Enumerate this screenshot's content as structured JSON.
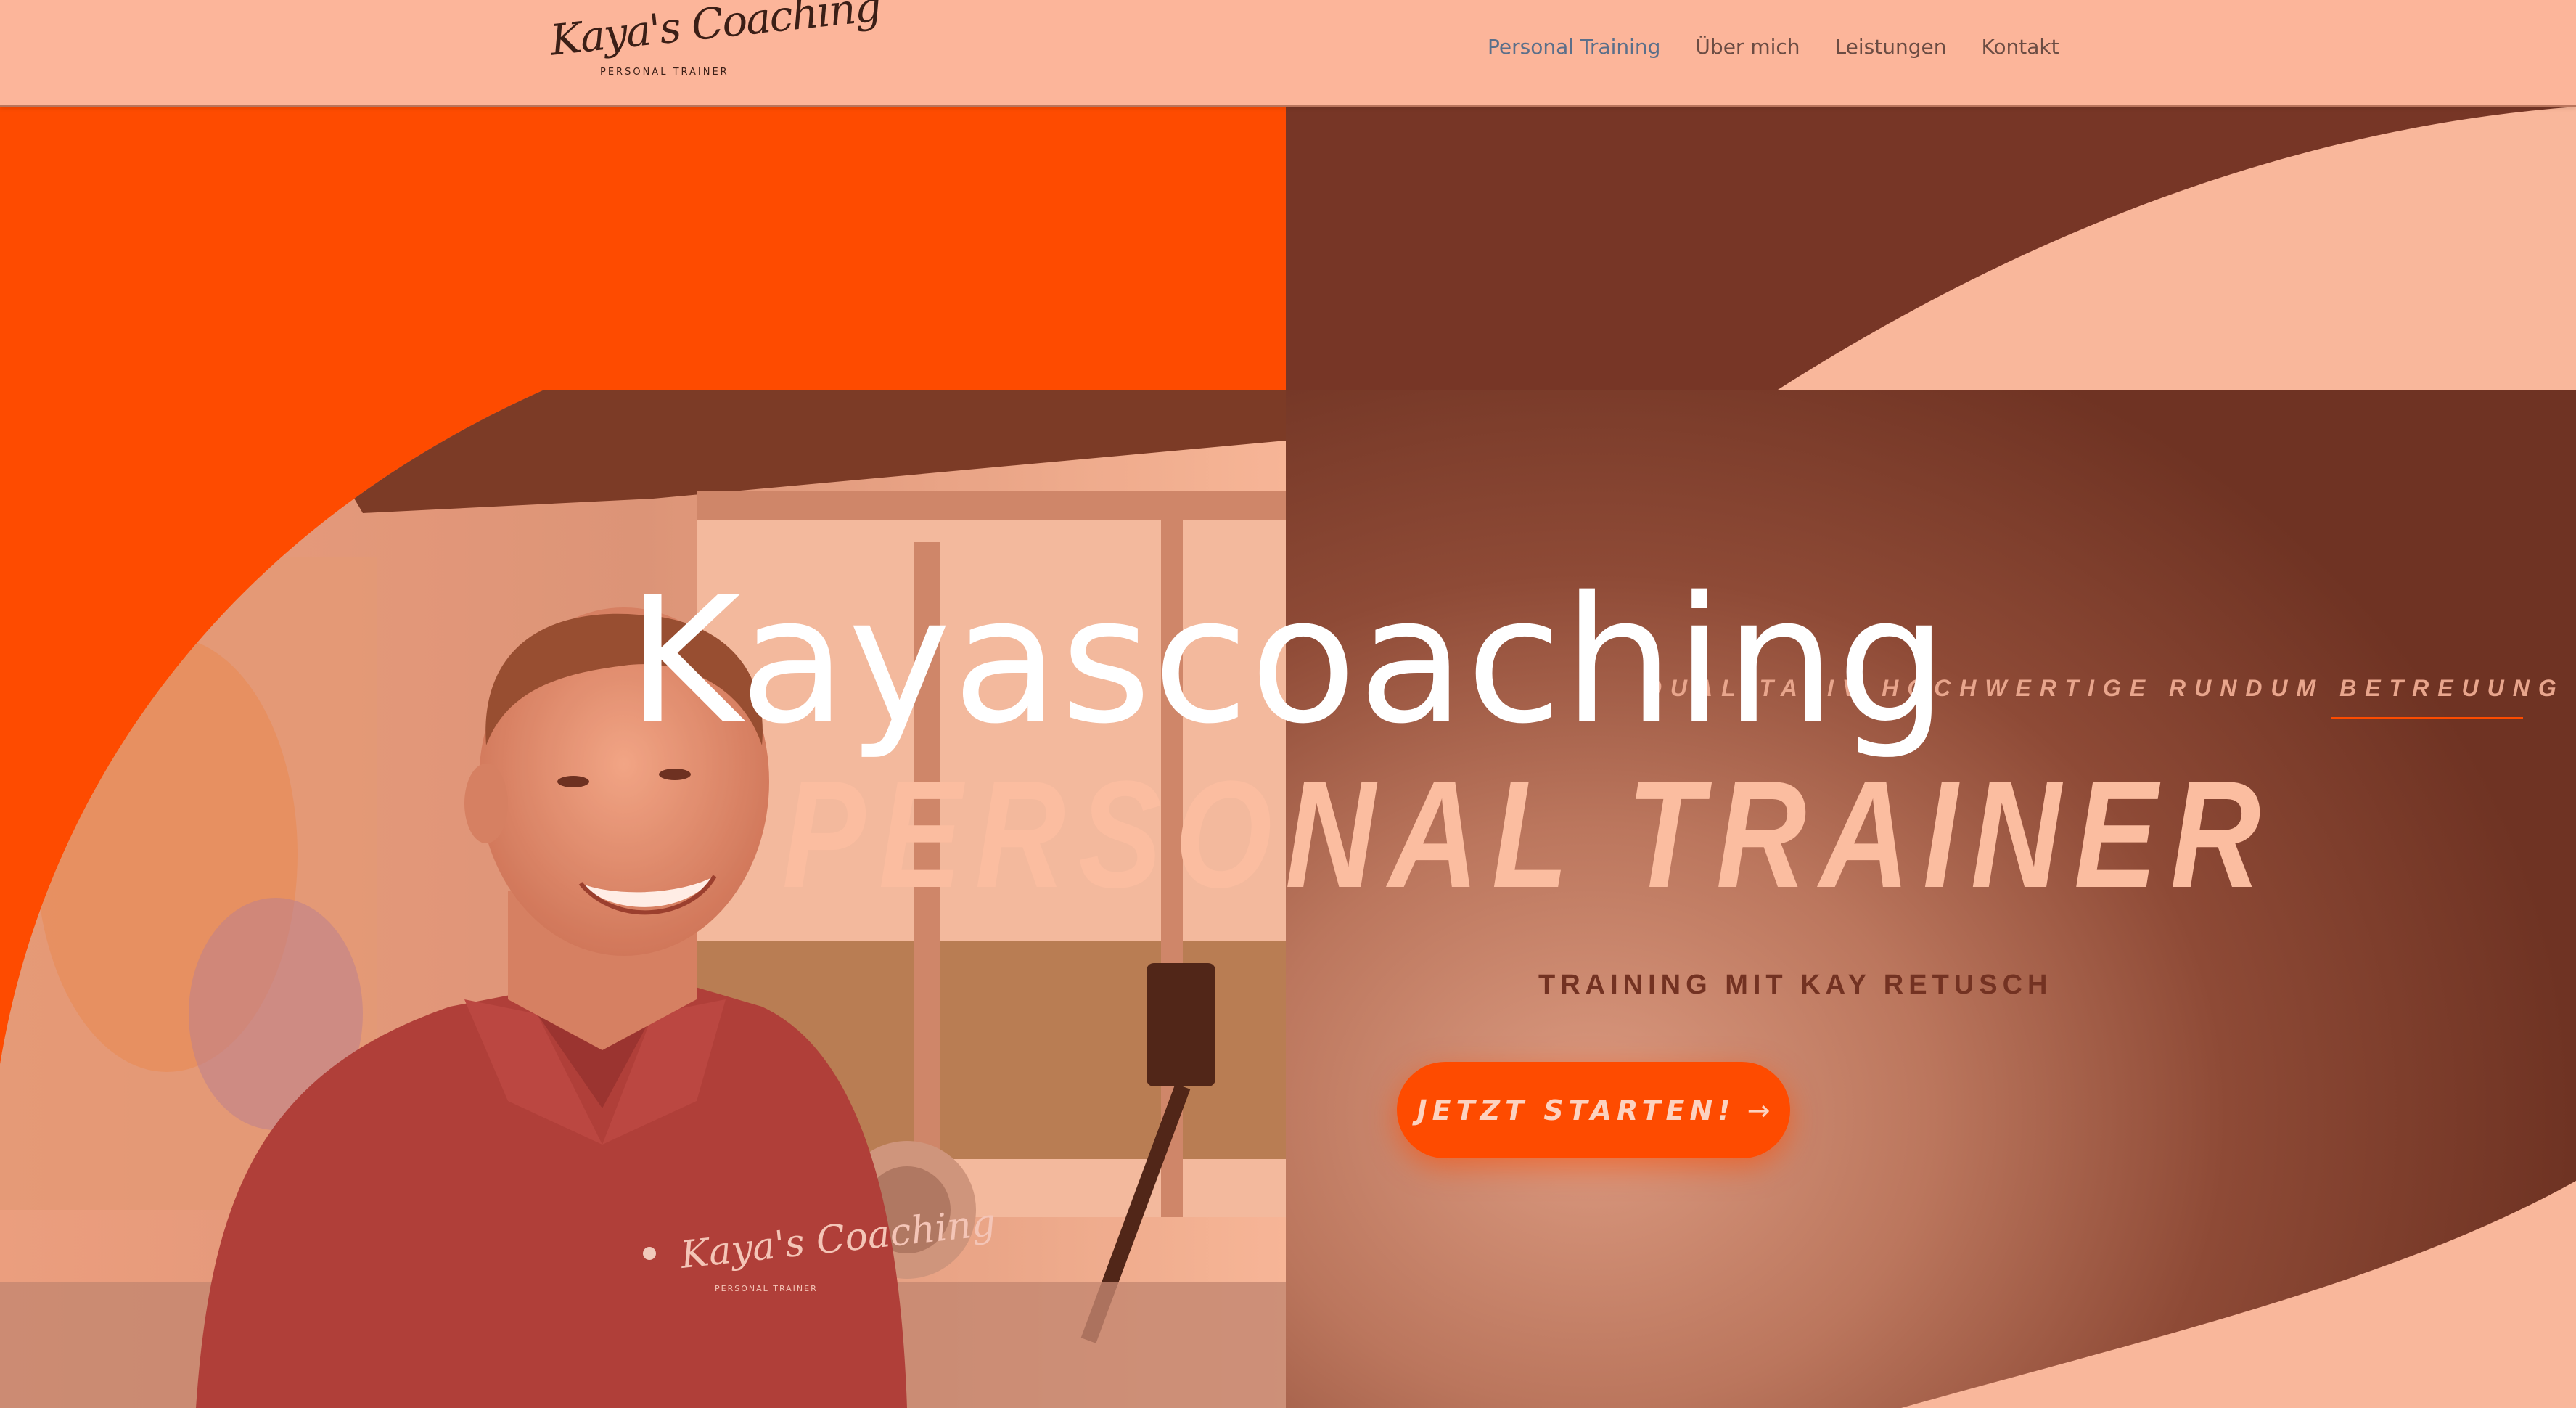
{
  "header": {
    "logo": {
      "script_text": "Kaya's Coaching",
      "subtitle": "PERSONAL TRAINER"
    },
    "nav": [
      {
        "label": "Personal Training",
        "active": true
      },
      {
        "label": "Über mich",
        "active": false
      },
      {
        "label": "Leistungen",
        "active": false
      },
      {
        "label": "Kontakt",
        "active": false
      }
    ]
  },
  "hero": {
    "site_title": "Kayascoaching",
    "tagline": "QUALITATIV HOCHWERTIGE RUNDUM BETREUUNG",
    "headline": "PERSONAL TRAINER",
    "subheadline": "TRAINING MIT KAY RETUSCH",
    "cta_label": "JETZT STARTEN!",
    "cta_icon": "arrow-right-icon",
    "photo_shirt_logo": {
      "script": "Kaya's Coaching",
      "sub": "PERSONAL TRAINER"
    }
  },
  "colors": {
    "header_bg": "#fcb59a",
    "accent_orange": "#fe4b00",
    "dark_brown": "#773626",
    "peach": "#f9b79b",
    "nav_active": "#5b6f8a"
  }
}
